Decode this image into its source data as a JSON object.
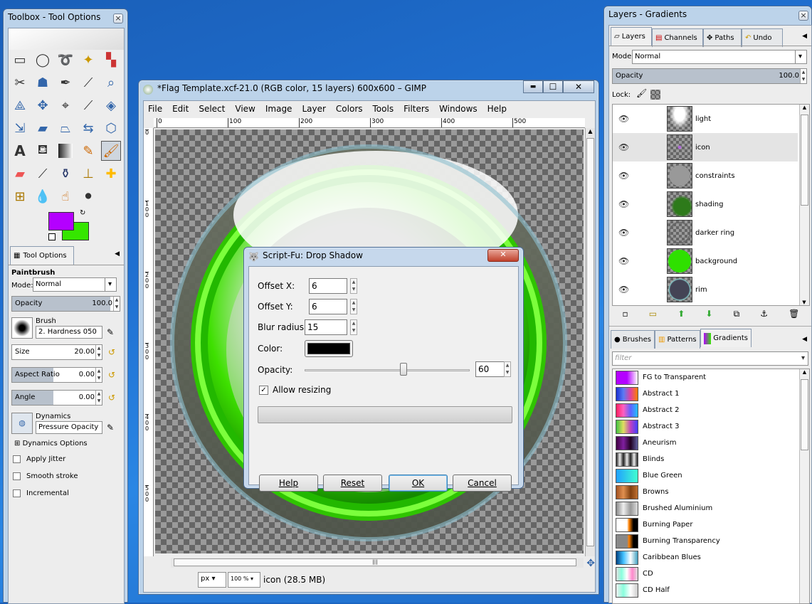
{
  "toolbox": {
    "title": "Toolbox - Tool Options",
    "close": "×",
    "fg_color": "#b400ff",
    "bg_color": "#35e600",
    "tool_options_tab": "Tool Options",
    "tool_name": "Paintbrush",
    "mode_label": "Mode:",
    "mode_value": "Normal",
    "opacity_label": "Opacity",
    "opacity_value": "100.0",
    "brush_label": "Brush",
    "brush_value": "2. Hardness 050",
    "size_label": "Size",
    "size_value": "20.00",
    "aspect_label": "Aspect Ratio",
    "aspect_value": "0.00",
    "angle_label": "Angle",
    "angle_value": "0.00",
    "dynamics_label": "Dynamics",
    "dynamics_value": "Pressure Opacity",
    "dynamics_options": "Dynamics Options",
    "apply_jitter": "Apply Jitter",
    "smooth_stroke": "Smooth stroke",
    "incremental": "Incremental"
  },
  "image_window": {
    "title": "*Flag Template.xcf-21.0 (RGB color, 15 layers) 600x600 – GIMP",
    "menu": [
      "File",
      "Edit",
      "Select",
      "View",
      "Image",
      "Layer",
      "Colors",
      "Tools",
      "Filters",
      "Windows",
      "Help"
    ],
    "ruler_h": [
      "0",
      "100",
      "200",
      "300",
      "400",
      "500"
    ],
    "ruler_v": [
      "0",
      "1\n0\n0",
      "2\n0\n0",
      "3\n0\n0",
      "4\n0\n0",
      "5\n0\n0"
    ],
    "unit": "px",
    "zoom": "100 %",
    "status": "icon (28.5 MB)",
    "min": "▬",
    "max": "☐",
    "close": "✕"
  },
  "dialog": {
    "title": "Script-Fu: Drop Shadow",
    "offset_x_label": "Offset X:",
    "offset_x_value": "6",
    "offset_y_label": "Offset Y:",
    "offset_y_value": "6",
    "blur_label": "Blur radius:",
    "blur_value": "15",
    "color_label": "Color:",
    "color_value": "#000000",
    "opacity_label": "Opacity:",
    "opacity_value": "60",
    "allow_resizing": "Allow resizing",
    "help": "Help",
    "reset": "Reset",
    "ok": "OK",
    "cancel": "Cancel",
    "close": "✕"
  },
  "layers_panel": {
    "title": "Layers - Gradients",
    "close": "×",
    "tabs": [
      "Layers",
      "Channels",
      "Paths",
      "Undo"
    ],
    "mode_label": "Mode:",
    "mode_value": "Normal",
    "opacity_label": "Opacity",
    "opacity_value": "100.0",
    "lock_label": "Lock:",
    "layers": [
      {
        "name": "light",
        "thumb": "light"
      },
      {
        "name": "icon",
        "thumb": "icon"
      },
      {
        "name": "constraints",
        "thumb": "constraints"
      },
      {
        "name": "shading",
        "thumb": "shading"
      },
      {
        "name": "darker ring",
        "thumb": "ring"
      },
      {
        "name": "background",
        "thumb": "bg"
      },
      {
        "name": "rim",
        "thumb": "rim"
      }
    ],
    "bottom_tabs": [
      "Brushes",
      "Patterns",
      "Gradients"
    ],
    "filter_placeholder": "filter",
    "gradients": [
      {
        "name": "FG to Transparent",
        "colors": "linear-gradient(90deg,#b400ff,#b400ff 50%,rgba(180,0,255,0))"
      },
      {
        "name": "Abstract 1",
        "colors": "linear-gradient(90deg,#1a2fd0,#5a7cf5,#e040a0,#ff8000)"
      },
      {
        "name": "Abstract 2",
        "colors": "linear-gradient(90deg,#ff2060,#ff60c0,#6060ff,#20c0ff)"
      },
      {
        "name": "Abstract 3",
        "colors": "linear-gradient(90deg,#40c040,#e0e060,#c040c0,#4040ff)"
      },
      {
        "name": "Aneurism",
        "colors": "linear-gradient(90deg,#400040,#8020a0,#200020,#6060a0)"
      },
      {
        "name": "Blinds",
        "colors": "repeating-linear-gradient(90deg,#222 0,#eee 5px,#222 10px)"
      },
      {
        "name": "Blue Green",
        "colors": "linear-gradient(90deg,#20a0ff,#40ffd0)"
      },
      {
        "name": "Browns",
        "colors": "linear-gradient(90deg,#a05020,#e09050,#804010,#c07030)"
      },
      {
        "name": "Brushed Aluminium",
        "colors": "linear-gradient(90deg,#888,#eee,#999,#ddd)"
      },
      {
        "name": "Burning Paper",
        "colors": "linear-gradient(90deg,#fff 50%,#ff8000 60%,#000 80%)"
      },
      {
        "name": "Burning Transparency",
        "colors": "linear-gradient(90deg,#888 50%,#ff8000 60%,#000 80%)"
      },
      {
        "name": "Caribbean Blues",
        "colors": "linear-gradient(90deg,#004080,#40c0ff,#ffffff,#40a0c0)"
      },
      {
        "name": "CD",
        "colors": "linear-gradient(90deg,#ddd,#8fd,#fff,#f8c,#ddd)"
      },
      {
        "name": "CD Half",
        "colors": "linear-gradient(90deg,#eee,#8fd,#fff,#ccc)"
      }
    ]
  }
}
